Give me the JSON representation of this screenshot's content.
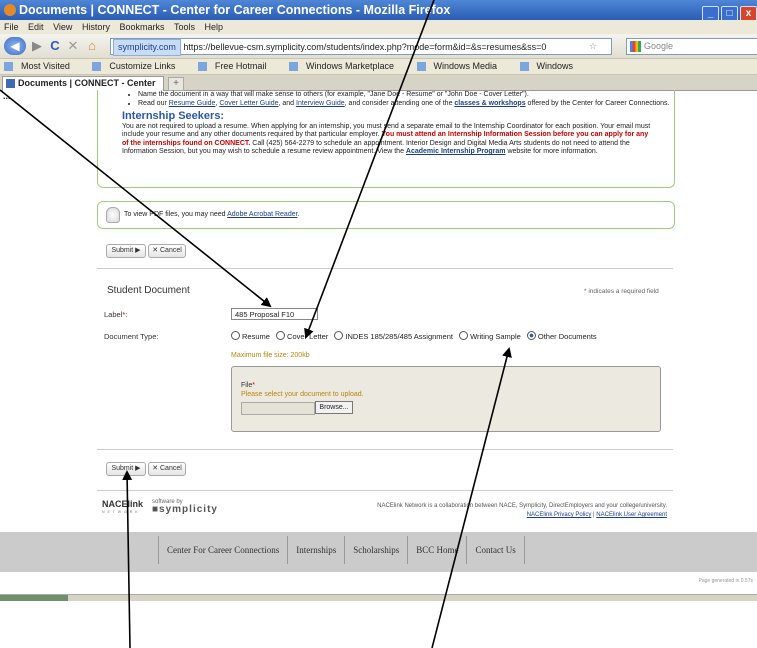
{
  "window": {
    "title": "Documents  |  CONNECT  -  Center for Career Connections  -  Mozilla Firefox",
    "min": "_",
    "max": "□",
    "close": "x"
  },
  "menu": [
    "File",
    "Edit",
    "View",
    "History",
    "Bookmarks",
    "Tools",
    "Help"
  ],
  "toolbar": {
    "back": "◀",
    "forward": "▶",
    "reload": "C",
    "stop": "✕",
    "home": "⌂",
    "site_badge": "symplicity.com",
    "url": "https://bellevue-csm.symplicity.com/students/index.php?mode=form&id=&s=resumes&ss=0",
    "bookmark_star": "☆",
    "search_placeholder": "Google"
  },
  "bookmarks": [
    "Most Visited",
    "Customize Links",
    "Free Hotmail",
    "Windows Marketplace",
    "Windows Media",
    "Windows"
  ],
  "tab": {
    "title": "Documents | CONNECT - Center ...",
    "new_tab": "+"
  },
  "info": {
    "bullet1": "Name the document in a way that will make sense to others (for example, \"Jane Doe - Resume\" or \"John Doe - Cover Letter\").",
    "bullet2_pre": "Read our ",
    "bullet2_link1": "Resume Guide",
    "bullet2_sep1": ", ",
    "bullet2_link2": "Cover Letter Guide",
    "bullet2_sep2": ", and ",
    "bullet2_link3": "Interview Guide",
    "bullet2_mid": ", and consider attending one of the ",
    "bullet2_link4": "classes & workshops",
    "bullet2_post": " offered by the Center for Career Connections.",
    "heading": "Internship Seekers:",
    "para1": "You are not required to upload a resume. When applying for an internship, you must send a separate email to the Internship Coordinator for each position. Your email must include your resume and any other documents required by that particular employer. ",
    "para_red": "You must attend an Internship Information Session before you can apply for any of the internships found on CONNECT.",
    "para2": " Call (425) 564-2279 to schedule an appointment. Interior Design and Digital Media Arts students do not need to attend the Information Session, but you may wish to schedule a resume review appointment. View the ",
    "para_link": "Academic Internship Program",
    "para3": " website for more information."
  },
  "pdf": {
    "text": "To view PDF files, you may need ",
    "link": "Adobe Acrobat Reader",
    "end": "."
  },
  "buttons": {
    "submit": "Submit ▶",
    "cancel": "✕ Cancel"
  },
  "form": {
    "section_title": "Student Document",
    "required_note": "* indicates a required field",
    "label_label": "Label",
    "required_mark": "*",
    "label_colon": ":",
    "label_value": "485 Proposal F10",
    "doctype_label": "Document Type:",
    "doc_types": [
      "Resume",
      "Cover Letter",
      "INDES 185/285/485 Assignment",
      "Writing Sample",
      "Other Documents"
    ],
    "selected_type": "Other Documents",
    "max_size": "Maximum file size: 200kb",
    "file_label": "File",
    "file_prompt": "Please select your document to upload.",
    "browse": "Browse..."
  },
  "footer": {
    "nace_logo": "NACElink",
    "nace_sub": "N E T W O R K",
    "symp_by": "software by",
    "symp_logo": "symplicity",
    "collab": "NACElink Network is a collaboration between NACE, Symplicity, DirectEmployers and your college/university.",
    "privacy": "NACElink Privacy Policy",
    "sep": " | ",
    "agreement": "NACElink User Agreement"
  },
  "site_nav": [
    "Center For Career Connections",
    "Internships",
    "Scholarships",
    "BCC Home",
    "Contact Us"
  ],
  "generated": "Page generated in 0.57s"
}
